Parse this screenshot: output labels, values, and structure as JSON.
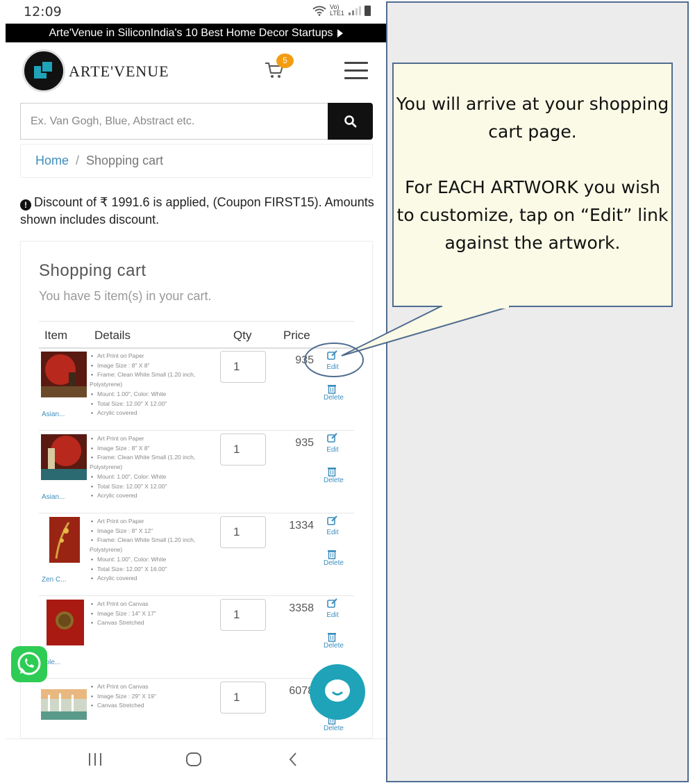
{
  "status": {
    "time": "12:09",
    "network": "Vo) LTE1"
  },
  "promo": {
    "text": "Arte'Venue in SiliconIndia's 10 Best Home Decor Startups"
  },
  "header": {
    "brand": "ARTE'VENUE",
    "cart_count": "5"
  },
  "search": {
    "placeholder": "Ex. Van Gogh, Blue, Abstract etc."
  },
  "breadcrumb": {
    "home": "Home",
    "separator": "/",
    "current": "Shopping cart"
  },
  "discount": {
    "icon": "!",
    "text": "Discount of ₹ 1991.6 is applied, (Coupon FIRST15). Amounts shown includes discount."
  },
  "cart": {
    "title": "Shopping cart",
    "subtitle": "You have 5 item(s) in your cart.",
    "columns": {
      "item": "Item",
      "details": "Details",
      "qty": "Qty",
      "price": "Price"
    },
    "edit_label": "Edit",
    "delete_label": "Delete",
    "items": [
      {
        "caption": "Asian...",
        "qty": "1",
        "price": "935",
        "details": [
          "Art Print on Paper",
          "Image Size : 8\" X 8\"",
          "Frame: Clean White Small (1.20 inch, Polystyrene)",
          "Mount: 1.00\", Color: White",
          "Total Size: 12.00\" X 12.00\"",
          "Acrylic covered"
        ]
      },
      {
        "caption": "Asian...",
        "qty": "1",
        "price": "935",
        "details": [
          "Art Print on Paper",
          "Image Size : 8\" X 8\"",
          "Frame: Clean White Small (1.20 inch, Polystyrene)",
          "Mount: 1.00\", Color: White",
          "Total Size: 12.00\" X 12.00\"",
          "Acrylic covered"
        ]
      },
      {
        "caption": "Zen C...",
        "qty": "1",
        "price": "1334",
        "details": [
          "Art Print on Paper",
          "Image Size : 8\" X 12\"",
          "Frame: Clean White Small (1.20 inch, Polystyrene)",
          "Mount: 1.00\", Color: White",
          "Total Size: 12.00\" X 16.00\"",
          "Acrylic covered"
        ]
      },
      {
        "caption": "pple...",
        "qty": "1",
        "price": "3358",
        "details": [
          "Art Print on Canvas",
          "Image Size : 14\" X 17\"",
          "Canvas Stretched"
        ]
      },
      {
        "caption": "",
        "qty": "1",
        "price": "6078",
        "details": [
          "Art Print on Canvas",
          "Image Size : 29\" X 19\"",
          "Canvas Stretched"
        ]
      }
    ]
  },
  "callout": {
    "paragraph1": "You will arrive at your shopping cart page.",
    "paragraph2": "For EACH ARTWORK you wish to customize, tap on “Edit” link against the artwork."
  },
  "colors": {
    "accent": "#3c8dbc",
    "badge": "#f39c12",
    "teal": "#1ea3b8",
    "whatsapp": "#2ecc54",
    "callout_border": "#4f6c8f",
    "callout_fill": "#fafae6"
  }
}
